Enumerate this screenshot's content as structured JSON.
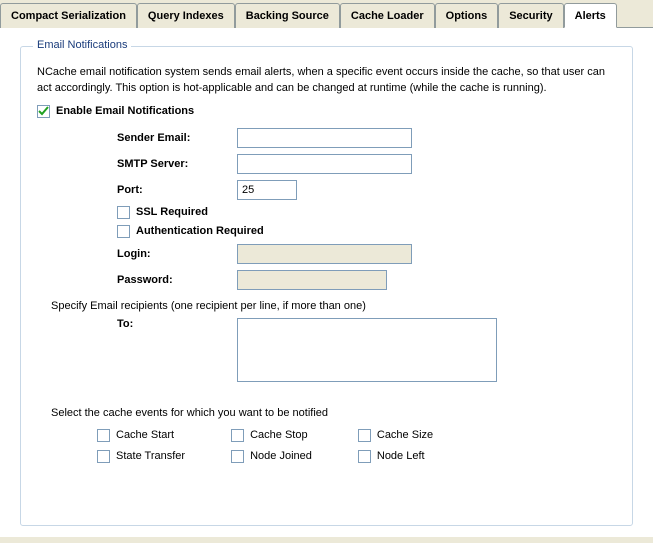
{
  "tabs": [
    {
      "label": "Compact Serialization",
      "active": false
    },
    {
      "label": "Query Indexes",
      "active": false
    },
    {
      "label": "Backing Source",
      "active": false
    },
    {
      "label": "Cache Loader",
      "active": false
    },
    {
      "label": "Options",
      "active": false
    },
    {
      "label": "Security",
      "active": false
    },
    {
      "label": "Alerts",
      "active": true
    }
  ],
  "section": {
    "title": "Email Notifications",
    "description": "NCache email notification system sends email alerts, when a specific event occurs inside the cache, so that user can act accordingly. This option is hot-applicable and can be changed at runtime (while the cache is running).",
    "enable_label": "Enable Email Notifications",
    "enable_checked": true,
    "sender_label": "Sender Email:",
    "sender_value": "",
    "smtp_label": "SMTP Server:",
    "smtp_value": "",
    "port_label": "Port:",
    "port_value": "25",
    "ssl_label": "SSL Required",
    "ssl_checked": false,
    "auth_label": "Authentication Required",
    "auth_checked": false,
    "login_label": "Login:",
    "login_value": "",
    "password_label": "Password:",
    "password_value": "",
    "recipients_hint": "Specify Email recipients (one recipient per line, if more than one)",
    "to_label": "To:",
    "to_value": "",
    "events_hint": "Select the cache events for which you want to be notified",
    "events": {
      "cache_start": "Cache Start",
      "cache_stop": "Cache Stop",
      "cache_size": "Cache Size",
      "state_transfer": "State Transfer",
      "node_joined": "Node Joined",
      "node_left": "Node Left"
    }
  }
}
